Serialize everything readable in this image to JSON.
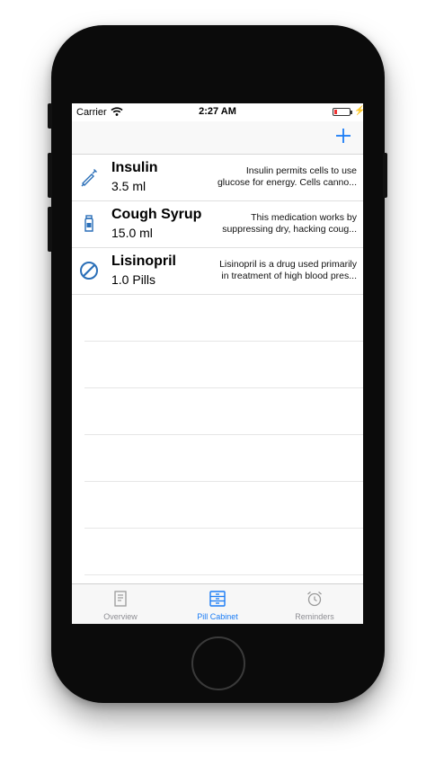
{
  "status_bar": {
    "carrier": "Carrier",
    "time": "2:27 AM",
    "battery_level": 0.2
  },
  "navbar": {
    "add_icon": "plus-icon"
  },
  "medications": [
    {
      "name": "Insulin",
      "dose": "3.5 ml",
      "desc_line1": "Insulin permits cells to use",
      "desc_line2": "glucose for energy. Cells canno...",
      "icon": "syringe-icon"
    },
    {
      "name": "Cough Syrup",
      "dose": "15.0 ml",
      "desc_line1": "This medication works by",
      "desc_line2": "suppressing dry, hacking coug...",
      "icon": "bottle-icon"
    },
    {
      "name": "Lisinopril",
      "dose": "1.0 Pills",
      "desc_line1": "Lisinopril is a drug used primarily",
      "desc_line2": "in treatment of high blood pres...",
      "icon": "pill-icon"
    }
  ],
  "tabs": [
    {
      "label": "Overview",
      "icon": "document-icon",
      "active": false
    },
    {
      "label": "Pill Cabinet",
      "icon": "cabinet-icon",
      "active": true
    },
    {
      "label": "Reminders",
      "icon": "alarm-clock-icon",
      "active": false
    }
  ],
  "colors": {
    "accent": "#1a7cf5",
    "inactive": "#8e8e93",
    "battery_low": "#ee3333"
  }
}
